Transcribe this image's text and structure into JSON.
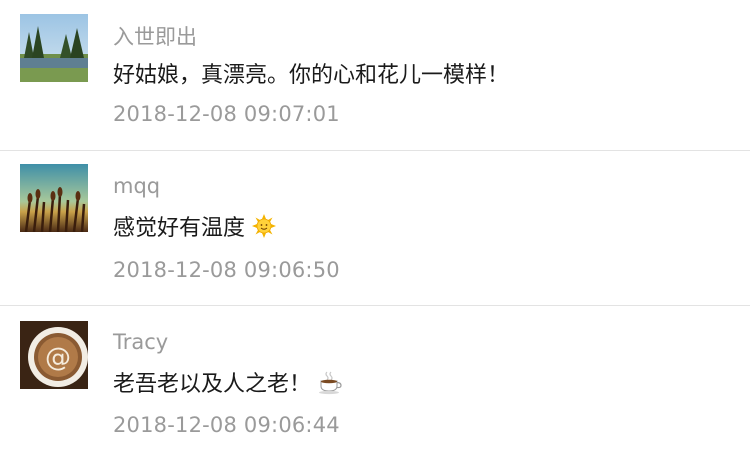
{
  "comments": [
    {
      "author": "入世即出",
      "text": "好姑娘，真漂亮。你的心和花儿一模样！",
      "emoji": "",
      "time": "2018-12-08 09:07:01",
      "avatar": "landscape-avatar"
    },
    {
      "author": "mqq",
      "text": "感觉好有温度",
      "emoji": "sun-emoji",
      "time": "2018-12-08 09:06:50",
      "avatar": "wheat-field-avatar"
    },
    {
      "author": "Tracy",
      "text": "老吾老以及人之老！",
      "emoji": "coffee-cup-emoji",
      "time": "2018-12-08 09:06:44",
      "avatar": "latte-art-avatar"
    }
  ],
  "colors": {
    "name": "#9a9a9a",
    "text": "#1a1a1a",
    "divider": "#e3e3e3"
  }
}
